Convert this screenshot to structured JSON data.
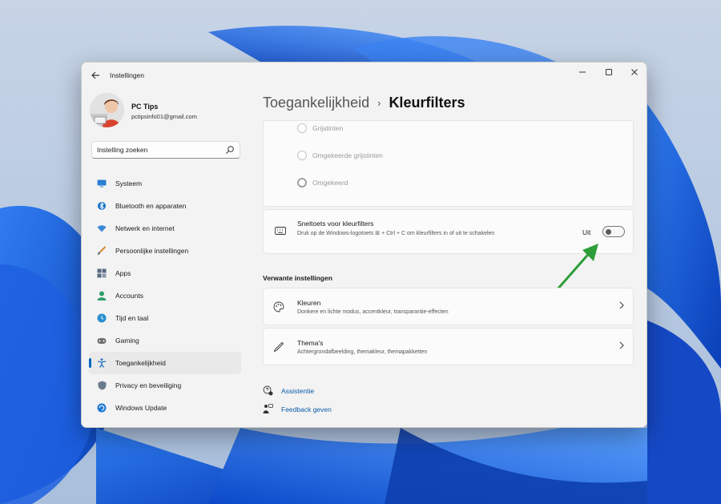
{
  "window": {
    "app_title": "Instellingen",
    "back_icon": "arrow-left-icon",
    "controls": [
      "minimize-icon",
      "maximize-icon",
      "close-icon"
    ]
  },
  "profile": {
    "name": "PC Tips",
    "email": "pctipsinfo01@gmail.com"
  },
  "search": {
    "value": "Instelling zoeken",
    "icon": "search-icon"
  },
  "sidebar": {
    "items": [
      {
        "label": "Systeem",
        "icon": "monitor-icon",
        "color": "#2b7fd4"
      },
      {
        "label": "Bluetooth en apparaten",
        "icon": "bluetooth-icon",
        "color": "#1a73c9"
      },
      {
        "label": "Netwerk en internet",
        "icon": "wifi-icon",
        "color": "#3a8ad6"
      },
      {
        "label": "Persoonlijke instellingen",
        "icon": "brush-icon",
        "color": "#d9822b"
      },
      {
        "label": "Apps",
        "icon": "apps-icon",
        "color": "#5a6b80"
      },
      {
        "label": "Accounts",
        "icon": "person-icon",
        "color": "#2e9e6a"
      },
      {
        "label": "Tijd en taal",
        "icon": "globe-clock-icon",
        "color": "#2a8fd0"
      },
      {
        "label": "Gaming",
        "icon": "gamepad-icon",
        "color": "#6e6e6e"
      },
      {
        "label": "Toegankelijkheid",
        "icon": "accessibility-icon",
        "color": "#1f6fc2",
        "active": true
      },
      {
        "label": "Privacy en beveiliging",
        "icon": "shield-icon",
        "color": "#6b7b8c"
      },
      {
        "label": "Windows Update",
        "icon": "update-icon",
        "color": "#1f7ad6"
      }
    ]
  },
  "breadcrumb": {
    "parent": "Toegankelijkheid",
    "separator": "›",
    "current": "Kleurfilters"
  },
  "color_filters": {
    "options": [
      {
        "label": "Grijstinten",
        "selected": false
      },
      {
        "label": "Omgekeerde grijstinten",
        "selected": false
      },
      {
        "label": "Omgekeerd",
        "selected": true
      }
    ]
  },
  "shortcut": {
    "title": "Sneltoets voor kleurfilters",
    "description": "Druk op de Windows-logotoets ⊞ + Ctrl + C om kleurfilters in of uit te schakelen",
    "state_label": "Uit",
    "on": false,
    "icon": "keyboard-icon"
  },
  "related": {
    "title": "Verwante instellingen",
    "items": [
      {
        "title": "Kleuren",
        "description": "Donkere en lichte modus, accentkleur, transparantie-effecten",
        "icon": "palette-icon"
      },
      {
        "title": "Thema's",
        "description": "Achtergrondafbeelding, themakleur, themapakketten",
        "icon": "pen-icon"
      }
    ]
  },
  "help": {
    "assist": "Assistentie",
    "feedback": "Feedback geven"
  },
  "colors": {
    "accent": "#0067c0",
    "arrow": "#2e9e3a"
  }
}
